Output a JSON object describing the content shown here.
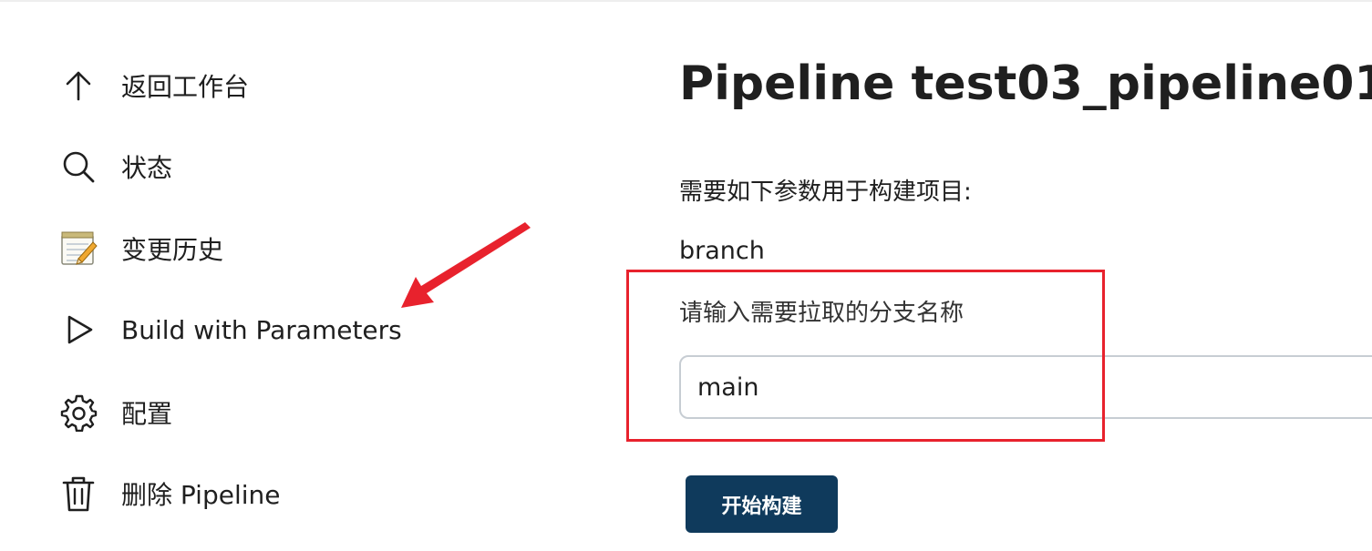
{
  "sidebar": {
    "items": [
      {
        "label": "返回工作台",
        "icon": "arrow-up-icon"
      },
      {
        "label": "状态",
        "icon": "search-icon"
      },
      {
        "label": "变更历史",
        "icon": "notepad-icon"
      },
      {
        "label": "Build with Parameters",
        "icon": "play-icon"
      },
      {
        "label": "配置",
        "icon": "gear-icon"
      },
      {
        "label": "删除 Pipeline",
        "icon": "trash-icon"
      }
    ]
  },
  "main": {
    "title": "Pipeline test03_pipeline01",
    "intro": "需要如下参数用于构建项目:",
    "parameter": {
      "name": "branch",
      "description": "请输入需要拉取的分支名称",
      "value": "main"
    },
    "build_button_label": "开始构建"
  },
  "colors": {
    "annotation": "#e8222d",
    "button_bg": "#0f3a5c",
    "input_border": "#c7cdd3"
  }
}
